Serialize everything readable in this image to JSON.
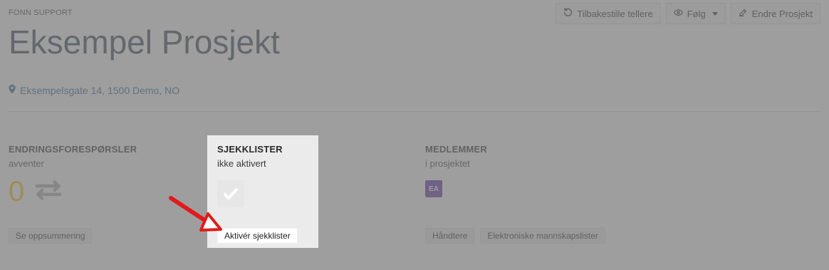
{
  "header": {
    "org_label": "FONN SUPPORT",
    "project_title": "Eksempel Prosjekt",
    "address": "Eksempelsgate 14, 1500 Demo, NO"
  },
  "toolbar": {
    "reset_label": "Tilbakestille tellere",
    "follow_label": "Følg",
    "edit_label": "Endre Prosjekt"
  },
  "cards": {
    "requests": {
      "title": "ENDRINGSFORESPØRSLER",
      "subtitle": "avventer",
      "count": "0",
      "action_label": "Se oppsummering"
    },
    "checklists": {
      "title": "SJEKKLISTER",
      "subtitle": "ikke aktivert",
      "action_label": "Aktivér sjekklister"
    },
    "members": {
      "title": "MEDLEMMER",
      "subtitle": "i prosjektet",
      "avatar_initials": "EA",
      "action_manage": "Håndtere",
      "action_crew": "Elektroniske mannskapslister"
    }
  },
  "icons": {
    "location": "map-marker-icon",
    "reset": "undo-icon",
    "follow": "eye-icon",
    "edit": "edit-icon",
    "exchange": "exchange-icon",
    "checklist": "checkmark-icon",
    "arrow": "pointer-arrow"
  },
  "colors": {
    "accent_yellow": "#f3c200",
    "link_blue": "#1f5d8c",
    "avatar_purple": "#5b2aa0",
    "arrow_red": "#e11b1b"
  }
}
